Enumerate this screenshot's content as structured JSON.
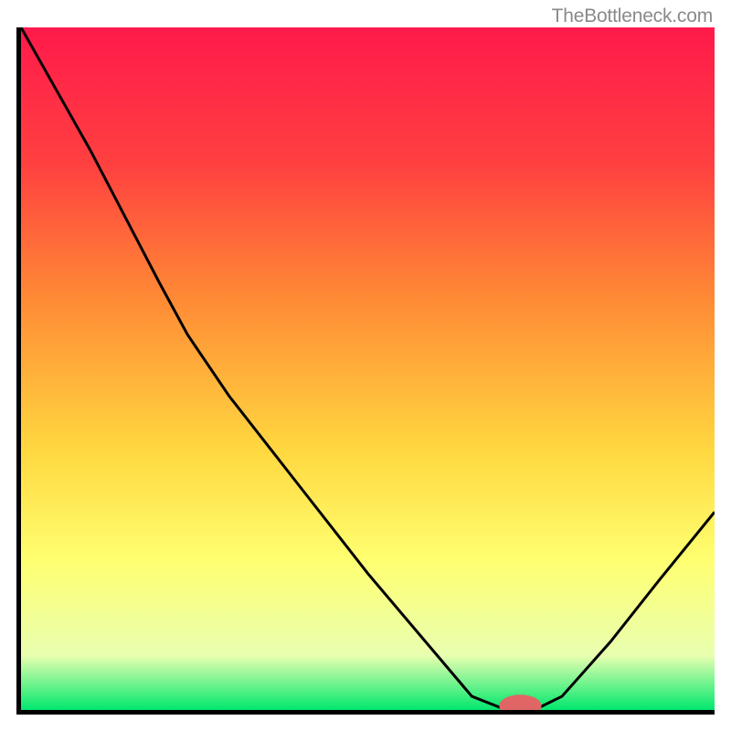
{
  "watermark_text": "TheBottleneck.com",
  "chart_data": {
    "type": "line",
    "title": "",
    "xlabel": "",
    "ylabel": "",
    "xlim": [
      0,
      100
    ],
    "ylim": [
      0,
      100
    ],
    "gradient_stops": [
      {
        "offset": 0,
        "color": "#ff1a4b"
      },
      {
        "offset": 20,
        "color": "#ff4040"
      },
      {
        "offset": 40,
        "color": "#ff8b35"
      },
      {
        "offset": 62,
        "color": "#ffd840"
      },
      {
        "offset": 78,
        "color": "#ffff70"
      },
      {
        "offset": 92,
        "color": "#e9ffb0"
      },
      {
        "offset": 100,
        "color": "#00e86e"
      }
    ],
    "series": [
      {
        "name": "bottleneck-curve",
        "color": "#000000",
        "points": [
          {
            "x": 0,
            "y": 100.0
          },
          {
            "x": 10,
            "y": 82.0
          },
          {
            "x": 20,
            "y": 62.5
          },
          {
            "x": 24,
            "y": 55.0
          },
          {
            "x": 30,
            "y": 46.0
          },
          {
            "x": 40,
            "y": 33.0
          },
          {
            "x": 50,
            "y": 20.0
          },
          {
            "x": 60,
            "y": 8.0
          },
          {
            "x": 65,
            "y": 2.0
          },
          {
            "x": 70,
            "y": 0.0
          },
          {
            "x": 74,
            "y": 0.0
          },
          {
            "x": 78,
            "y": 2.0
          },
          {
            "x": 85,
            "y": 10.0
          },
          {
            "x": 92,
            "y": 19.0
          },
          {
            "x": 100,
            "y": 29.0
          }
        ]
      }
    ],
    "marker": {
      "x": 72,
      "y": 0,
      "rx": 3.0,
      "ry": 1.6,
      "color": "#e06666"
    }
  }
}
